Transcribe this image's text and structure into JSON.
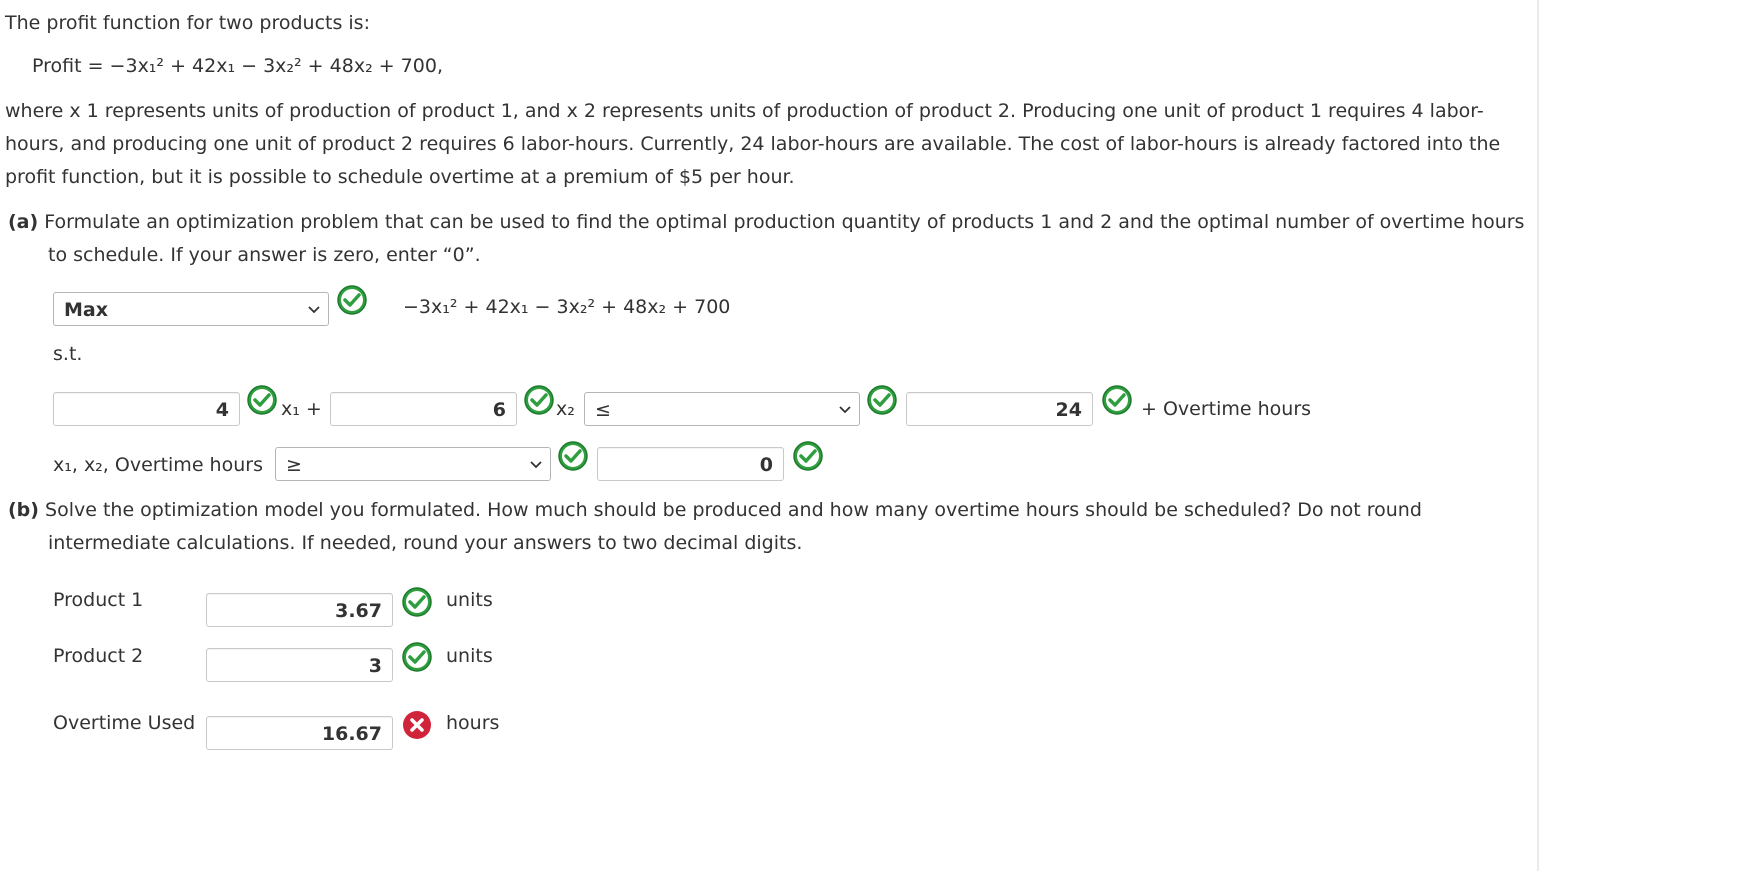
{
  "intro": {
    "line1": "The profit function for two products is:",
    "profit_eq": "Profit = −3x₁² + 42x₁ − 3x₂² + 48x₂ + 700,",
    "description": "where x 1 represents units of production of product 1, and x 2 represents units of production of product 2. Producing one unit of product 1 requires 4 labor-hours, and producing one unit of product 2 requires 6 labor-hours. Currently, 24 labor-hours are available. The cost of labor-hours is already factored into the profit function, but it is possible to schedule overtime at a premium of $5 per hour."
  },
  "part_a": {
    "tag": "(a)",
    "prompt": "Formulate an optimization problem that can be used to find the optimal production quantity of products 1 and 2 and the optimal number of overtime hours to schedule. If your answer is zero, enter “0”.",
    "objective_select": "Max",
    "objective_expr": "−3x₁² + 42x₁ − 3x₂² + 48x₂ + 700",
    "st_label": "s.t.",
    "constraint": {
      "coef1": "4",
      "x1_plus": "x₁ +",
      "coef2": "6",
      "x2": "x₂",
      "relation": "≤",
      "rhs": "24",
      "suffix": "+ Overtime hours"
    },
    "nonneg": {
      "vars_label": "x₁, x₂, Overtime hours",
      "relation": "≥",
      "rhs": "0"
    }
  },
  "part_b": {
    "tag": "(b)",
    "prompt": "Solve the optimization model you formulated. How much should be produced and how many overtime hours should be scheduled? Do not round intermediate calculations. If needed, round your answers to two decimal digits.",
    "rows": [
      {
        "label": "Product 1",
        "value": "3.67",
        "unit": "units",
        "status": "correct"
      },
      {
        "label": "Product 2",
        "value": "3",
        "unit": "units",
        "status": "correct"
      },
      {
        "label": "Overtime Used",
        "value": "16.67",
        "unit": "hours",
        "status": "incorrect"
      }
    ]
  },
  "colors": {
    "check_green": "#2e9e3f",
    "error_red": "#d0243a"
  }
}
